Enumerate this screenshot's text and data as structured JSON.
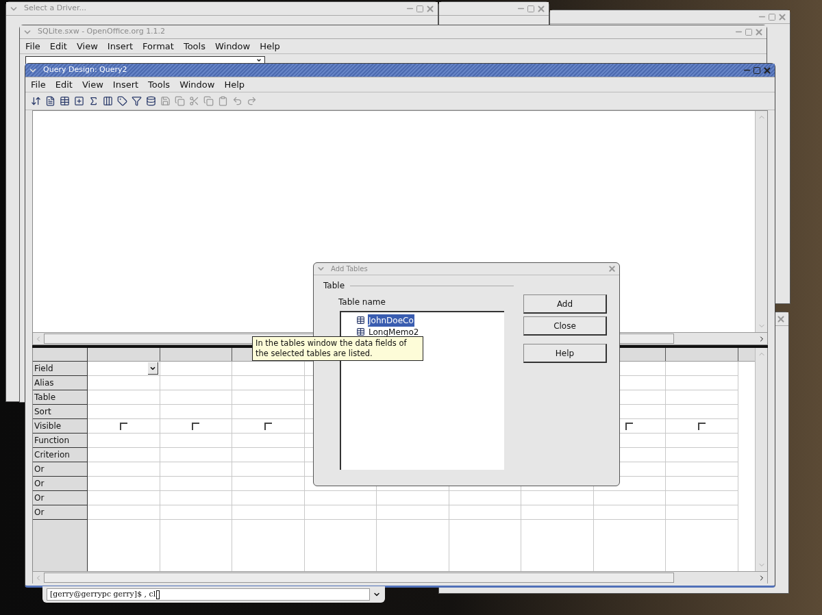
{
  "back_windows": [
    {
      "title": "Select a Driver..."
    }
  ],
  "document_window": {
    "title": "SQLite.sxw - OpenOffice.org 1.1.2",
    "menu": [
      "File",
      "Edit",
      "View",
      "Insert",
      "Format",
      "Tools",
      "Window",
      "Help"
    ]
  },
  "query_window": {
    "title": "Query Design: Query2",
    "menu": [
      "File",
      "Edit",
      "View",
      "Insert",
      "Tools",
      "Window",
      "Help"
    ],
    "grid": {
      "row_labels": [
        "Field",
        "Alias",
        "Table",
        "Sort",
        "Visible",
        "Function",
        "Criterion",
        "Or",
        "Or",
        "Or",
        "Or"
      ],
      "columns": [
        {
          "field_dropdown": true,
          "visible_checked": false
        },
        {
          "visible_checked": false
        },
        {
          "visible_checked": false
        },
        {},
        {},
        {},
        {},
        {
          "visible_checked": false
        },
        {
          "visible_checked": false
        }
      ]
    }
  },
  "add_tables": {
    "title": "Add Tables",
    "group": "Table",
    "list_label": "Table name",
    "tables": [
      {
        "name": "JohnDoeCo",
        "selected": true
      },
      {
        "name": "LongMemo2",
        "selected": false
      }
    ],
    "buttons": [
      "Add",
      "Close",
      "Help"
    ]
  },
  "tooltip": "In the tables window the data fields of the selected tables are listed.",
  "terminal": {
    "command_line": "[gerry@gerrypc gerry]$ , cl"
  }
}
